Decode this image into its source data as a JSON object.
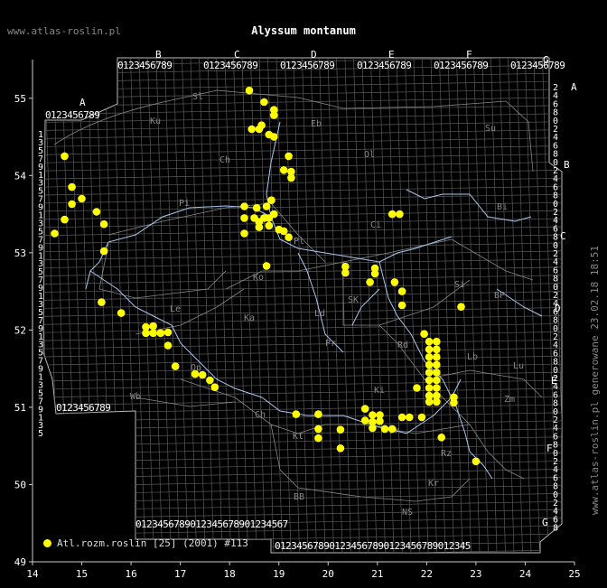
{
  "site": "www.atlas-roslin.pl",
  "title": "Alyssum montanum",
  "side_text": "www.atlas-roslin.pl generowane 23.02.18 18:51",
  "legend": {
    "label": "Atl.rozm.roslin [25] (2001) #113",
    "color": "#ffff00"
  },
  "axis": {
    "x_ticks": [
      "14",
      "15",
      "16",
      "17",
      "18",
      "19",
      "20",
      "21",
      "22",
      "23",
      "24",
      "25"
    ],
    "y_ticks": [
      "49",
      "50",
      "51",
      "52",
      "53",
      "54",
      "55"
    ]
  },
  "grid_letters_top": [
    "A",
    "B",
    "C",
    "D",
    "E",
    "F",
    "G"
  ],
  "grid_letters_right": [
    "A",
    "B",
    "C",
    "D",
    "E",
    "F",
    "G"
  ],
  "grid_digits": "0123456789",
  "regions": [
    "Sl",
    "Ku",
    "Eb",
    "Ch",
    "Ol",
    "Su",
    "Pi",
    "Ci",
    "Bi",
    "Ko",
    "Pl",
    "Ka",
    "Ld",
    "SK",
    "Si",
    "BP",
    "Le",
    "Pr",
    "Rd",
    "Lb",
    "Lu",
    "Wb",
    "Ch",
    "Op",
    "Ki",
    "Kt",
    "Tr",
    "Zm",
    "Rz",
    "BB",
    "NS",
    "Kr"
  ],
  "chart_data": {
    "type": "scatter",
    "series": [
      {
        "name": "Atl.rozm.roslin [25] (2001) #113",
        "points": [
          [
            18.4,
            55.1
          ],
          [
            18.7,
            54.95
          ],
          [
            18.9,
            54.85
          ],
          [
            18.9,
            54.78
          ],
          [
            18.65,
            54.65
          ],
          [
            18.45,
            54.6
          ],
          [
            18.6,
            54.6
          ],
          [
            18.8,
            54.53
          ],
          [
            18.9,
            54.5
          ],
          [
            19.2,
            54.25
          ],
          [
            19.1,
            54.07
          ],
          [
            19.25,
            54.05
          ],
          [
            19.25,
            53.97
          ],
          [
            14.65,
            54.25
          ],
          [
            14.8,
            53.85
          ],
          [
            15.0,
            53.7
          ],
          [
            14.8,
            53.63
          ],
          [
            15.3,
            53.53
          ],
          [
            14.65,
            53.43
          ],
          [
            15.45,
            53.37
          ],
          [
            14.45,
            53.25
          ],
          [
            15.45,
            53.02
          ],
          [
            18.3,
            53.6
          ],
          [
            18.55,
            53.58
          ],
          [
            18.75,
            53.6
          ],
          [
            18.85,
            53.68
          ],
          [
            18.3,
            53.45
          ],
          [
            18.5,
            53.45
          ],
          [
            18.6,
            53.4
          ],
          [
            18.7,
            53.45
          ],
          [
            18.8,
            53.45
          ],
          [
            18.9,
            53.5
          ],
          [
            18.6,
            53.33
          ],
          [
            18.8,
            53.35
          ],
          [
            19.0,
            53.3
          ],
          [
            19.1,
            53.28
          ],
          [
            18.3,
            53.25
          ],
          [
            19.2,
            53.2
          ],
          [
            18.75,
            52.83
          ],
          [
            20.35,
            52.82
          ],
          [
            20.35,
            52.74
          ],
          [
            20.95,
            52.8
          ],
          [
            20.95,
            52.73
          ],
          [
            21.3,
            53.5
          ],
          [
            21.45,
            53.5
          ],
          [
            20.85,
            52.62
          ],
          [
            21.35,
            52.62
          ],
          [
            21.5,
            52.5
          ],
          [
            21.5,
            52.32
          ],
          [
            22.7,
            52.3
          ],
          [
            15.4,
            52.36
          ],
          [
            15.8,
            52.22
          ],
          [
            16.3,
            52.04
          ],
          [
            16.45,
            52.05
          ],
          [
            16.3,
            51.96
          ],
          [
            16.45,
            51.96
          ],
          [
            16.6,
            51.96
          ],
          [
            16.75,
            51.97
          ],
          [
            16.75,
            51.8
          ],
          [
            16.9,
            51.53
          ],
          [
            17.3,
            51.43
          ],
          [
            17.45,
            51.42
          ],
          [
            17.6,
            51.35
          ],
          [
            17.7,
            51.26
          ],
          [
            21.95,
            51.95
          ],
          [
            22.05,
            51.85
          ],
          [
            22.2,
            51.85
          ],
          [
            22.2,
            51.75
          ],
          [
            22.05,
            51.75
          ],
          [
            22.05,
            51.65
          ],
          [
            22.2,
            51.65
          ],
          [
            22.05,
            51.55
          ],
          [
            22.2,
            51.55
          ],
          [
            22.05,
            51.45
          ],
          [
            22.2,
            51.45
          ],
          [
            22.05,
            51.35
          ],
          [
            22.2,
            51.35
          ],
          [
            22.05,
            51.25
          ],
          [
            22.2,
            51.25
          ],
          [
            22.05,
            51.15
          ],
          [
            22.2,
            51.15
          ],
          [
            22.05,
            51.07
          ],
          [
            22.2,
            51.07
          ],
          [
            22.55,
            51.13
          ],
          [
            22.55,
            51.06
          ],
          [
            21.8,
            51.25
          ],
          [
            19.35,
            50.91
          ],
          [
            19.8,
            50.91
          ],
          [
            19.8,
            50.72
          ],
          [
            19.8,
            50.6
          ],
          [
            20.25,
            50.71
          ],
          [
            20.25,
            50.47
          ],
          [
            20.75,
            50.98
          ],
          [
            20.75,
            50.83
          ],
          [
            20.9,
            50.9
          ],
          [
            21.05,
            50.9
          ],
          [
            20.9,
            50.81
          ],
          [
            21.05,
            50.82
          ],
          [
            20.9,
            50.73
          ],
          [
            21.15,
            50.72
          ],
          [
            21.3,
            50.72
          ],
          [
            21.5,
            50.87
          ],
          [
            21.65,
            50.87
          ],
          [
            21.9,
            50.87
          ],
          [
            22.3,
            50.61
          ],
          [
            23.0,
            50.3
          ]
        ]
      }
    ],
    "xlim": [
      14,
      25
    ],
    "ylim": [
      49,
      55.5
    ]
  }
}
